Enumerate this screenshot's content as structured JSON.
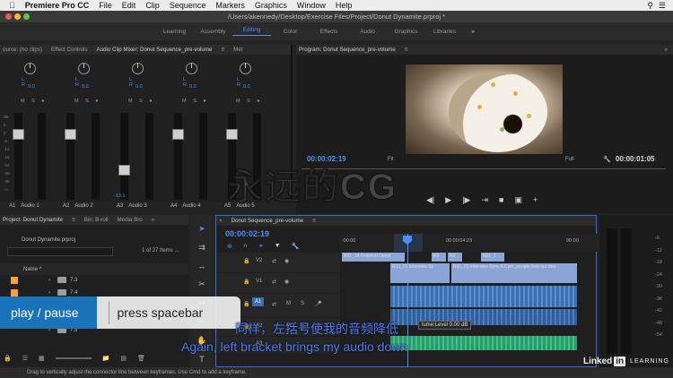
{
  "menubar": {
    "app": "Premiere Pro CC",
    "items": [
      "File",
      "Edit",
      "Clip",
      "Sequence",
      "Markers",
      "Graphics",
      "Window",
      "Help"
    ]
  },
  "titlebar": {
    "path": "/Users/akennedy/Desktop/Exercise Files/Project/Donut Dynamite.prproj *"
  },
  "workspaces": {
    "items": [
      "Learning",
      "Assembly",
      "Editing",
      "Color",
      "Effects",
      "Audio",
      "Graphics",
      "Libraries"
    ],
    "active": "Editing",
    "more": "»"
  },
  "mixer": {
    "tabs": [
      "ource: (no clips)",
      "Effect Controls",
      "Audio Clip Mixer: Donut Sequence_pre-volume",
      "Met"
    ],
    "active_tab": "Audio Clip Mixer: Donut Sequence_pre-volume",
    "lr_label": "L   R",
    "msr": "M S ●",
    "channels": [
      {
        "id": "A1",
        "name": "Audio 1",
        "pan": "0.0",
        "fader": "0.0",
        "fader_db": 0
      },
      {
        "id": "A2",
        "name": "Audio 2",
        "pan": "0.0",
        "fader": "0.0",
        "fader_db": 0
      },
      {
        "id": "A3",
        "name": "Audio 3",
        "pan": "0.0",
        "fader": "-13.1",
        "fader_db": -13.1
      },
      {
        "id": "A4",
        "name": "Audio 4",
        "pan": "0.0",
        "fader": "0.0",
        "fader_db": 0
      },
      {
        "id": "A5",
        "name": "Audio 5",
        "pan": "0.0",
        "fader": "0.0",
        "fader_db": 0
      }
    ],
    "db_scale": [
      "dB",
      "6",
      "0",
      "-6",
      "-12",
      "-18",
      "-24",
      "-30",
      "-36",
      "-∞"
    ]
  },
  "program": {
    "title": "Program: Donut Sequence_pre-volume",
    "timecode_left": "00:00:02:19",
    "fit": "Fit",
    "quality": "Full",
    "timecode_right": "00:00:01:05"
  },
  "project": {
    "tabs": [
      "Project: Donut Dynamite",
      "Bin: B-roll",
      "Media Bro"
    ],
    "file": "Donut Dynamite.prproj",
    "search_placeholder": "",
    "count": "1 of 27 Items ...",
    "column": "Name ^",
    "rows": [
      "7.3",
      "7.4",
      "7.5"
    ]
  },
  "timeline": {
    "title": "Donut Sequence_pre-volume",
    "timecode": "00:00:02:19",
    "ruler": [
      ":00:00",
      "00:00:04:23",
      "00:00"
    ],
    "tracks": [
      {
        "label": "V2",
        "clips": [
          "R01_14 Finished Donut",
          "R0",
          "R0",
          "R01_1"
        ]
      },
      {
        "label": "V1",
        "clips": [
          "R13_01 Interview Sy",
          "R01_01 Interview Sync A Cam_people love our don"
        ]
      },
      {
        "label": "A1",
        "clips": []
      },
      {
        "label": "A2",
        "clips": []
      },
      {
        "label": "A3",
        "clips": []
      }
    ],
    "tooltip": "lume:Level  0.00 dB"
  },
  "overlay": {
    "left": "play / pause",
    "right": "press spacebar"
  },
  "subtitles": {
    "zh": "同样，左括号使我的音频降低",
    "en": "Again, left bracket brings my audio down"
  },
  "watermark": "永远的CG",
  "status": "Drag to vertically adjust the connector line between keyframes. Use Cmd to add a keyframe.",
  "branding": {
    "linkedin": "Linked",
    "in": "in",
    "learning": "LEARNING"
  },
  "meter_scale": [
    "-6",
    "-12",
    "-18",
    "-24",
    "-30",
    "-36",
    "-42",
    "-48",
    "-54"
  ],
  "colors": {
    "accent": "#4a8ff7",
    "overlay_blue": "#1a72b8",
    "clip_orange": "#f3a338",
    "audio_green": "#2c9a6f"
  }
}
